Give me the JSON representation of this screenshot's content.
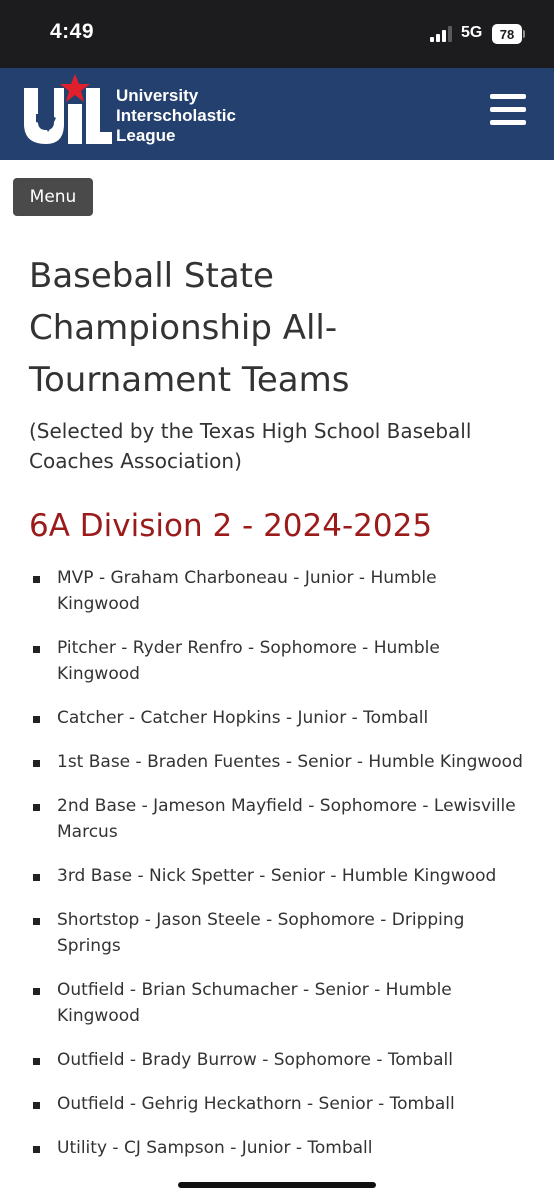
{
  "status_bar": {
    "time": "4:49",
    "network": "5G",
    "battery": "78"
  },
  "header": {
    "logo_line1": "University",
    "logo_line2": "Interscholastic",
    "logo_line3": "League",
    "logo_mark": "UIL",
    "colors": {
      "header_bg": "#23406e",
      "star": "#e0202a"
    }
  },
  "nav": {
    "menu_label": "Menu"
  },
  "page": {
    "title_line1": "Baseball State",
    "title_line2": "Championship All-",
    "title_line3": "Tournament Teams",
    "subtitle_line1": "(Selected by the Texas High School Baseball",
    "subtitle_line2": "Coaches Association)",
    "section_heading": "6A Division 2 - 2024-2025",
    "section_color": "#9b1b1b"
  },
  "roster": [
    {
      "line1": "MVP - Graham Charboneau - Junior - Humble",
      "line2": "Kingwood"
    },
    {
      "line1": "Pitcher - Ryder Renfro - Sophomore - Humble",
      "line2": "Kingwood"
    },
    {
      "line1": "Catcher - Catcher Hopkins - Junior - Tomball",
      "line2": ""
    },
    {
      "line1": "1st Base - Braden Fuentes - Senior - Humble Kingwood",
      "line2": ""
    },
    {
      "line1": "2nd Base - Jameson Mayfield - Sophomore - Lewisville",
      "line2": "Marcus"
    },
    {
      "line1": "3rd Base - Nick Spetter - Senior - Humble Kingwood",
      "line2": ""
    },
    {
      "line1": "Shortstop - Jason Steele - Sophomore - Dripping",
      "line2": "Springs"
    },
    {
      "line1": "Outfield - Brian Schumacher - Senior - Humble",
      "line2": "Kingwood"
    },
    {
      "line1": "Outfield - Brady Burrow - Sophomore - Tomball",
      "line2": ""
    },
    {
      "line1": "Outfield - Gehrig Heckathorn - Senior - Tomball",
      "line2": ""
    },
    {
      "line1": "Utility - CJ Sampson - Junior - Tomball",
      "line2": ""
    }
  ]
}
